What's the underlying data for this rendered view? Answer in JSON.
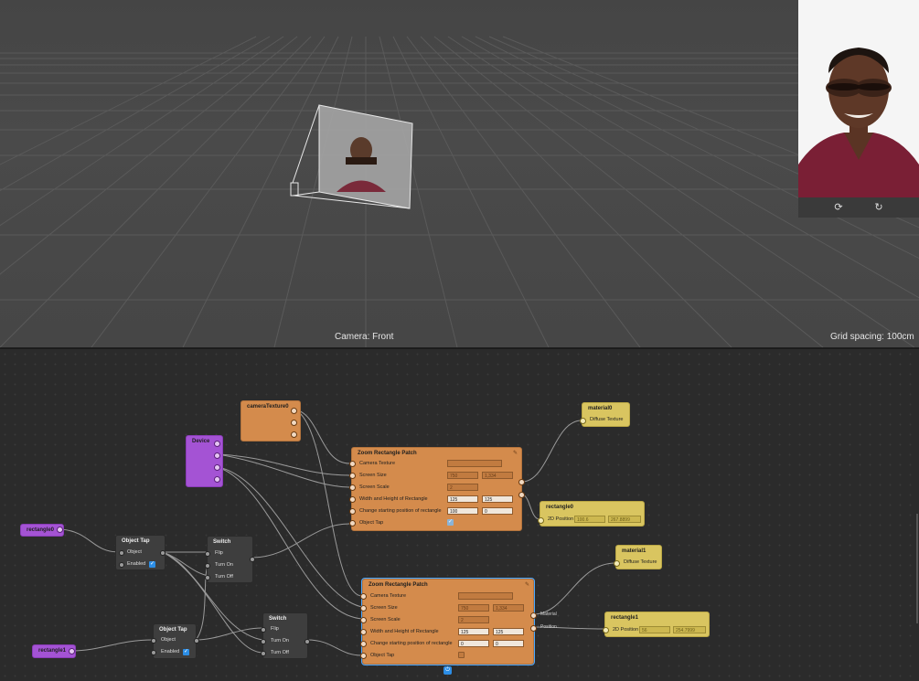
{
  "viewport": {
    "camera_label": "Camera: Front",
    "grid_label": "Grid spacing: 100cm"
  },
  "simulator": {
    "buttons": [
      {
        "icon": "camera-switch-icon",
        "glyph": "⟳"
      },
      {
        "icon": "rotate-device-icon",
        "glyph": "↻"
      }
    ]
  },
  "nodes": {
    "cameraTexture": {
      "title": "cameraTexture0"
    },
    "device": {
      "title": "Device"
    },
    "rectangle0": {
      "title": "rectangle0"
    },
    "rectangle1": {
      "title": "rectangle1"
    },
    "objectTap0": {
      "title": "Object Tap",
      "object": "Object",
      "enabled": "Enabled"
    },
    "objectTap1": {
      "title": "Object Tap",
      "object": "Object",
      "enabled": "Enabled"
    },
    "switch0": {
      "title": "Switch",
      "flip": "Flip",
      "on": "Turn On",
      "off": "Turn Off"
    },
    "switch1": {
      "title": "Switch",
      "flip": "Flip",
      "on": "Turn On",
      "off": "Turn Off"
    },
    "zoom0": {
      "title": "Zoom Rectangle Patch",
      "rows": [
        "Camera Texture",
        "Screen Size",
        "Screen Scale",
        "Width and Height of Rectangle",
        "Change starting position of rectangle",
        "Object Tap"
      ],
      "screen_size": [
        "750",
        "1,334"
      ],
      "screen_scale": "2",
      "wh": [
        "125",
        "125"
      ],
      "start": [
        "100",
        "0"
      ]
    },
    "zoom1": {
      "title": "Zoom Rectangle Patch",
      "rows": [
        "Camera Texture",
        "Screen Size",
        "Screen Scale",
        "Width and Height of Rectangle",
        "Change starting position of rectangle",
        "Object Tap"
      ],
      "screen_size": [
        "750",
        "1,334"
      ],
      "screen_scale": "2",
      "wh": [
        "125",
        "125"
      ],
      "start": [
        "0",
        "0"
      ],
      "out_material": "Material",
      "out_position": "Position"
    },
    "material0": {
      "title": "material0",
      "row": "Diffuse Texture"
    },
    "material1": {
      "title": "material1",
      "row": "Diffuse Texture"
    },
    "rect0out": {
      "title": "rectangle0",
      "row": "2D Position",
      "vals": [
        "100.6",
        "267.8899"
      ]
    },
    "rect1out": {
      "title": "rectangle1",
      "row": "2D Position",
      "vals": [
        "56",
        "254.7999"
      ]
    }
  },
  "colors": {
    "patch_orange": "#d48b4c",
    "device_purple": "#a453d4",
    "output_yellow": "#d9c560",
    "selection_blue": "#4aa7ff",
    "checkbox_blue": "#2c8ee6"
  }
}
